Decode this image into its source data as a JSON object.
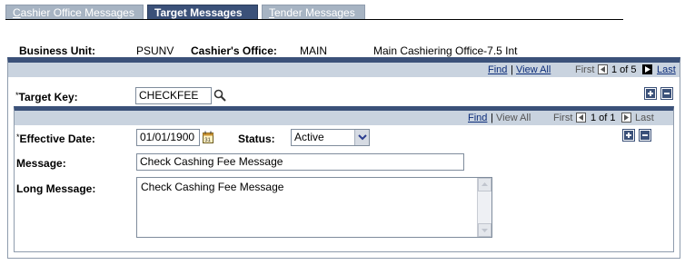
{
  "tabs": [
    {
      "label": "Cashier Office Messages",
      "accel": "C",
      "rest": "ashier Office Messages",
      "active": false
    },
    {
      "label": "Target Messages",
      "active": true
    },
    {
      "label": "Tender Messages",
      "accel": "T",
      "rest": "ender Messages",
      "active": false
    }
  ],
  "header": {
    "business_unit_label": "Business Unit:",
    "business_unit_value": "PSUNV",
    "cashiers_office_label": "Cashier's Office:",
    "cashiers_office_value": "MAIN",
    "cashiers_office_desc": "Main Cashiering Office-7.5 Int"
  },
  "outer_nav": {
    "find": "Find",
    "sep": "|",
    "view_all": "View All",
    "first": "First",
    "count": "1 of 5",
    "last": "Last"
  },
  "target_key": {
    "label": "Target Key:",
    "required_mark": "*",
    "value": "CHECKFEE",
    "lookup_icon": "magnifier-icon"
  },
  "inner_nav": {
    "find": "Find",
    "sep": "|",
    "view_all": "View All",
    "first": "First",
    "count": "1 of 1",
    "last": "Last"
  },
  "effective_date": {
    "label": "Effective Date:",
    "required_mark": "*",
    "value": "01/01/1900",
    "calendar_icon": "calendar-icon"
  },
  "status": {
    "label": "Status:",
    "value": "Active"
  },
  "message": {
    "label": "Message:",
    "value": "Check Cashing Fee Message"
  },
  "long_message": {
    "label": "Long Message:",
    "value": "Check Cashing Fee Message"
  },
  "colors": {
    "header_blue": "#3b5179",
    "nav_bar": "#c9d3df",
    "tab_inactive": "#a7b4c3",
    "link": "#0c2d7a"
  }
}
